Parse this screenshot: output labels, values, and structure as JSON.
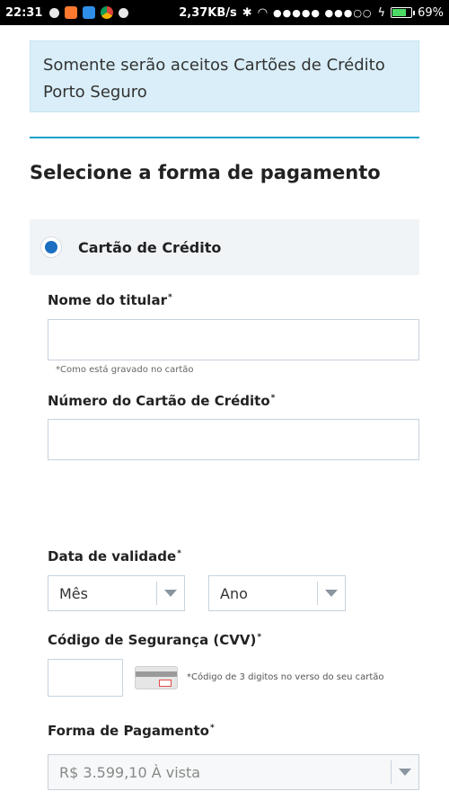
{
  "status_bar": {
    "time": "22:31",
    "network_speed": "2,37KB/s",
    "battery_level": "69%",
    "battery_fraction": 0.69
  },
  "notice": {
    "text_line1": "Somente serão aceitos Cartões de Crédito",
    "text_line2": "Porto Seguro"
  },
  "section_title": "Selecione a forma de pagamento",
  "payment_option": {
    "label": "Cartão de Crédito",
    "selected": true
  },
  "form": {
    "holder_name": {
      "label": "Nome do titular",
      "required_mark": "*",
      "value": "",
      "hint": "*Como está gravado no cartão"
    },
    "card_number": {
      "label": "Número do Cartão de Crédito",
      "required_mark": "*",
      "value": ""
    },
    "expiry": {
      "label": "Data de validade",
      "required_mark": "*",
      "month_value": "Mês",
      "year_value": "Ano"
    },
    "cvv": {
      "label": "Código de Segurança (CVV)",
      "required_mark": "*",
      "value": "",
      "hint": "*Código de 3 digitos no verso do seu cartão"
    },
    "payment_method": {
      "label": "Forma de Pagamento",
      "required_mark": "*",
      "value": "R$ 3.599,10 À vista"
    }
  },
  "colors": {
    "accent": "#1aa1c8",
    "radio": "#1c6fc1",
    "notice_bg": "#d9eef8"
  }
}
